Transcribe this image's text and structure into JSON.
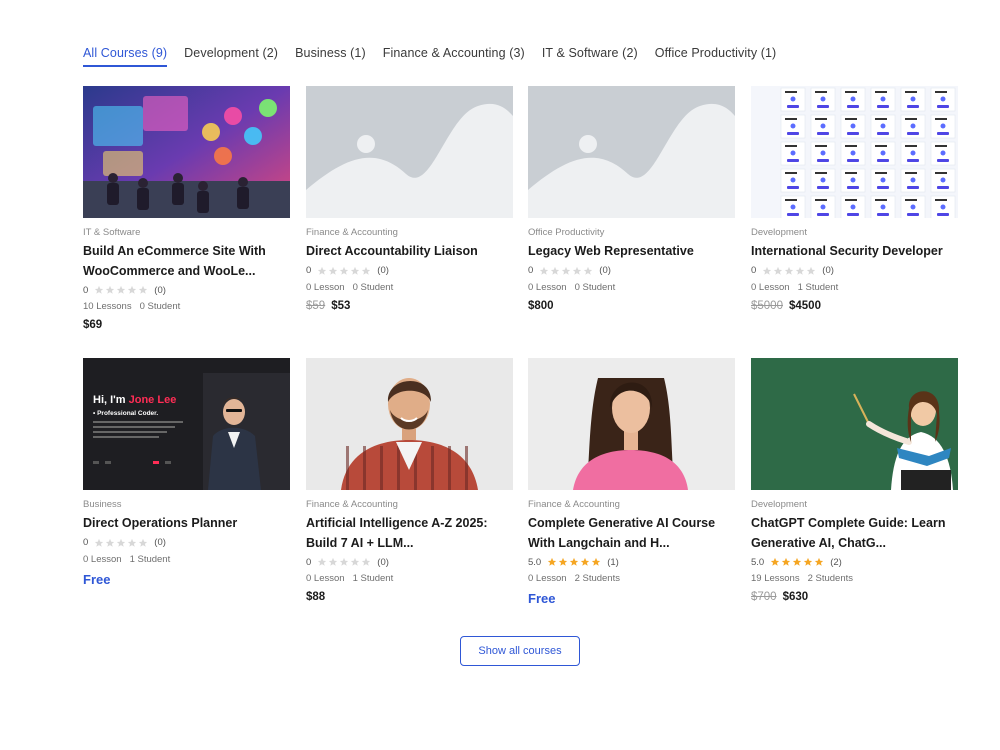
{
  "tabs": [
    {
      "label": "All Courses (9)",
      "active": true
    },
    {
      "label": "Development (2)",
      "active": false
    },
    {
      "label": "Business (1)",
      "active": false
    },
    {
      "label": "Finance & Accounting (3)",
      "active": false
    },
    {
      "label": "IT & Software (2)",
      "active": false
    },
    {
      "label": "Office Productivity (1)",
      "active": false
    }
  ],
  "colors": {
    "accent": "#2f57d6",
    "star_filled": "#f5a623",
    "star_empty": "#d8d8d8",
    "placeholder_bg": "#c9ced3"
  },
  "courses": [
    {
      "category": "IT & Software",
      "title": "Build An eCommerce Site With WooCommerce and WooLe...",
      "rating": "0",
      "stars": 0,
      "reviews": "(0)",
      "lessons": "10 Lessons",
      "students": "0 Student",
      "old_price": "",
      "price": "$69",
      "free": false,
      "thumb": "it-scene-image"
    },
    {
      "category": "Finance & Accounting",
      "title": "Direct Accountability Liaison",
      "rating": "0",
      "stars": 0,
      "reviews": "(0)",
      "lessons": "0 Lesson",
      "students": "0 Student",
      "old_price": "$59",
      "price": "$53",
      "free": false,
      "thumb": "placeholder-image"
    },
    {
      "category": "Office Productivity",
      "title": "Legacy Web Representative",
      "rating": "0",
      "stars": 0,
      "reviews": "(0)",
      "lessons": "0 Lesson",
      "students": "0 Student",
      "old_price": "",
      "price": "$800",
      "free": false,
      "thumb": "placeholder-image"
    },
    {
      "category": "Development",
      "title": "International Security Developer",
      "rating": "0",
      "stars": 0,
      "reviews": "(0)",
      "lessons": "0 Lesson",
      "students": "1 Student",
      "old_price": "$5000",
      "price": "$4500",
      "free": false,
      "thumb": "grid-screens-image"
    },
    {
      "category": "Business",
      "title": "Direct Operations Planner",
      "rating": "0",
      "stars": 0,
      "reviews": "(0)",
      "lessons": "0 Lesson",
      "students": "1 Student",
      "old_price": "",
      "price": "Free",
      "free": true,
      "thumb": "coder-portfolio-image",
      "thumb_text": {
        "greeting": "Hi, I'm ",
        "name": "Jone Lee",
        "role": "• Professional Coder."
      }
    },
    {
      "category": "Finance & Accounting",
      "title": "Artificial Intelligence A-Z 2025: Build 7 AI + LLM...",
      "rating": "0",
      "stars": 0,
      "reviews": "(0)",
      "lessons": "0 Lesson",
      "students": "1 Student",
      "old_price": "",
      "price": "$88",
      "free": false,
      "thumb": "man-portrait-image"
    },
    {
      "category": "Finance & Accounting",
      "title": "Complete Generative AI Course With Langchain and H...",
      "rating": "5.0",
      "stars": 5,
      "reviews": "(1)",
      "lessons": "0 Lesson",
      "students": "2 Students",
      "old_price": "",
      "price": "Free",
      "free": true,
      "thumb": "woman-portrait-image"
    },
    {
      "category": "Development",
      "title": "ChatGPT Complete Guide: Learn Generative AI, ChatG...",
      "rating": "5.0",
      "stars": 5,
      "reviews": "(2)",
      "lessons": "19 Lessons",
      "students": "2 Students",
      "old_price": "$700",
      "price": "$630",
      "free": false,
      "thumb": "teacher-chalkboard-image"
    }
  ],
  "show_all_label": "Show all courses"
}
